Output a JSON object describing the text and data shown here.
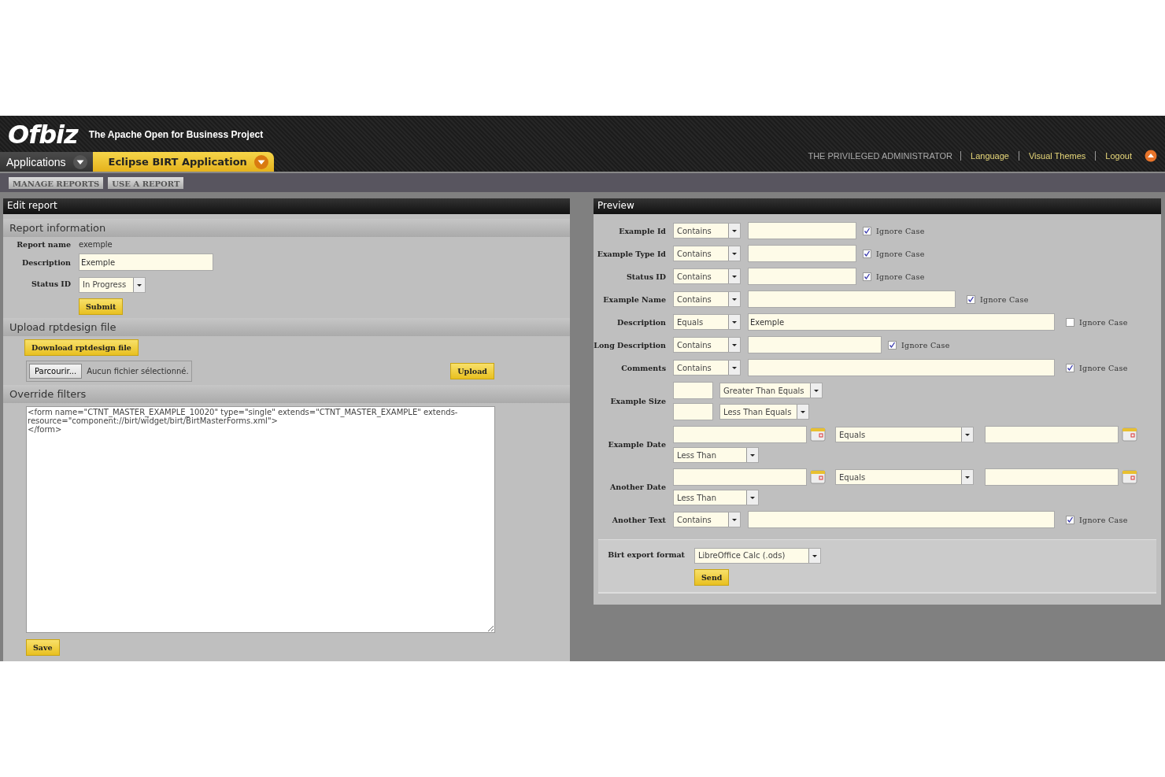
{
  "header": {
    "logo": "Ofbiz",
    "tagline": "The Apache Open for Business Project",
    "app_tabs": [
      {
        "label": "Applications",
        "selected": false
      },
      {
        "label": "Eclipse BIRT Application",
        "selected": true
      }
    ],
    "user": "THE PRIVILEGED ADMINISTRATOR",
    "links": [
      "Language",
      "Visual Themes",
      "Logout"
    ]
  },
  "subnav": [
    "MANAGE REPORTS",
    "USE A REPORT"
  ],
  "edit_report": {
    "title": "Edit report",
    "info_title": "Report information",
    "report_name_label": "Report name",
    "report_name": "exemple",
    "description_label": "Description",
    "description": "Exemple",
    "status_label": "Status ID",
    "status": "In Progress",
    "submit": "Submit",
    "upload_title": "Upload rptdesign file",
    "download": "Download rptdesign file",
    "browse": "Parcourir...",
    "no_file": "Aucun fichier sélectionné.",
    "upload": "Upload",
    "override_title": "Override filters",
    "override_text": "<form name=\"CTNT_MASTER_EXAMPLE_10020\" type=\"single\" extends=\"CTNT_MASTER_EXAMPLE\" extends-resource=\"component://birt/widget/birt/BirtMasterForms.xml\">\n</form>",
    "save": "Save"
  },
  "preview": {
    "title": "Preview",
    "filters": [
      {
        "kind": "text",
        "label": "Example Id",
        "operator": "Contains",
        "ignore_case_label": "Ignore Case",
        "ignore_case": true
      },
      {
        "kind": "text",
        "label": "Example Type Id",
        "operator": "Contains",
        "ignore_case_label": "Ignore Case",
        "ignore_case": true
      },
      {
        "kind": "text",
        "label": "Status ID",
        "operator": "Contains",
        "ignore_case_label": "Ignore Case",
        "ignore_case": true
      },
      {
        "kind": "text",
        "label": "Example Name",
        "operator": "Contains",
        "ignore_case_label": "Ignore Case",
        "ignore_case": true
      },
      {
        "kind": "text",
        "label": "Description",
        "operator": "Equals",
        "value": "Exemple",
        "ignore_case_label": "Ignore Case",
        "ignore_case": false
      },
      {
        "kind": "text",
        "label": "Long Description",
        "operator": "Contains",
        "ignore_case_label": "Ignore Case",
        "ignore_case": true
      },
      {
        "kind": "text",
        "label": "Comments",
        "operator": "Contains",
        "ignore_case_label": "Ignore Case",
        "ignore_case": true
      },
      {
        "kind": "range",
        "label": "Example Size",
        "operators": [
          "Greater Than Equals",
          "Less Than Equals"
        ]
      },
      {
        "kind": "date",
        "label": "Example Date",
        "operator": "Equals",
        "second_operator": "Less Than"
      },
      {
        "kind": "date",
        "label": "Another Date",
        "operator": "Equals",
        "second_operator": "Less Than"
      },
      {
        "kind": "text",
        "label": "Another Text",
        "operator": "Contains",
        "ignore_case_label": "Ignore Case",
        "ignore_case": true
      }
    ],
    "export_label": "Birt export format",
    "export_format": "LibreOffice Calc (.ods)",
    "send": "Send"
  }
}
